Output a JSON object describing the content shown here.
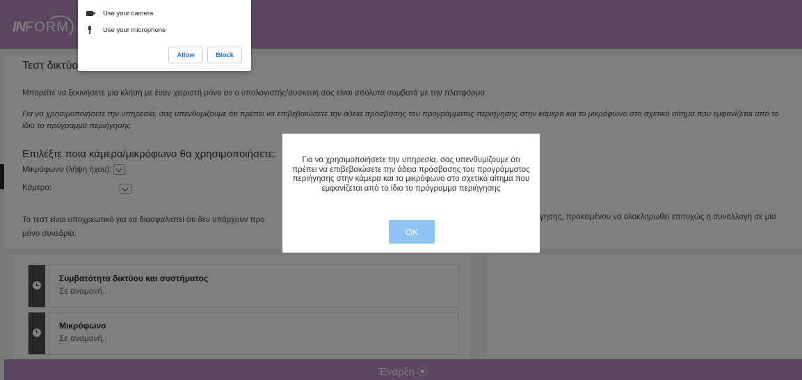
{
  "header": {
    "logo_in": "IN",
    "logo_orm": "FORM"
  },
  "main": {
    "title": "Τεστ δικτύο",
    "intro": "Μπορείτε να ξεκινήσετε μια κλήση με έναν χειριστή μόνο αν ο υπολογιστής/συσκευή σας είναι απόλυτα συμβατά με την πλατφόρμα",
    "reminder": "Για να χρησιμοποιήσετε την υπηρεσία, σας υπενθυμίζουμε ότι πρέπει να επιβεβαιώσετε την άδεια πρόσβασης του προγράμματος περιήγησης στην κάμερα και το μικρόφωνο στο σχετικό αίτημα που εμφανίζεται από το ίδιο το πρόγραμμα περιήγησης",
    "choose_title": "Επιλέξτε ποια κάμερα/μικρόφωνο θα χρησιμοποιήσετε:",
    "mic_label": "Μικρόφωνο (λήψη ήχου):",
    "cam_label": "Κάμερα:",
    "note_left": "Το τεστ είναι υποχρεωτικό για να διασφαλιστεί ότι δεν υπάρχουν προ",
    "note_left_2": "μόνο συνεδρία.",
    "note_right": "γησης, προκειμένου να ολοκληρωθεί επιτυχώς η συναλλαγή σε μία"
  },
  "steps": [
    {
      "title": "Συμβατότητα δικτύου και συστήματος",
      "status": "Σε αναμονή.."
    },
    {
      "title": "Μικρόφωνο",
      "status": "Σε αναμονή.."
    }
  ],
  "footer": {
    "start_label": "Έναρξη ⦿"
  },
  "permission": {
    "camera": "Use your camera",
    "microphone": "Use your microphone",
    "allow": "Allow",
    "block": "Block"
  },
  "modal": {
    "message": "Για να χρησιμοποιήσετε την υπηρεσία, σας υπενθυμίζουμε ότι πρέπει να επιβεβαιώσετε την άδεια πρόσβασης του προγράμματος περιήγησης στην κάμερα και το μικρόφωνο στο σχετικό αίτημα που εμφανίζεται από το ίδιο το πρόγραμμα περιήγησης",
    "ok": "OK"
  },
  "colors": {
    "brand": "#b58fbf",
    "ok_button": "#8ec5f5",
    "link": "#1a73e8"
  }
}
